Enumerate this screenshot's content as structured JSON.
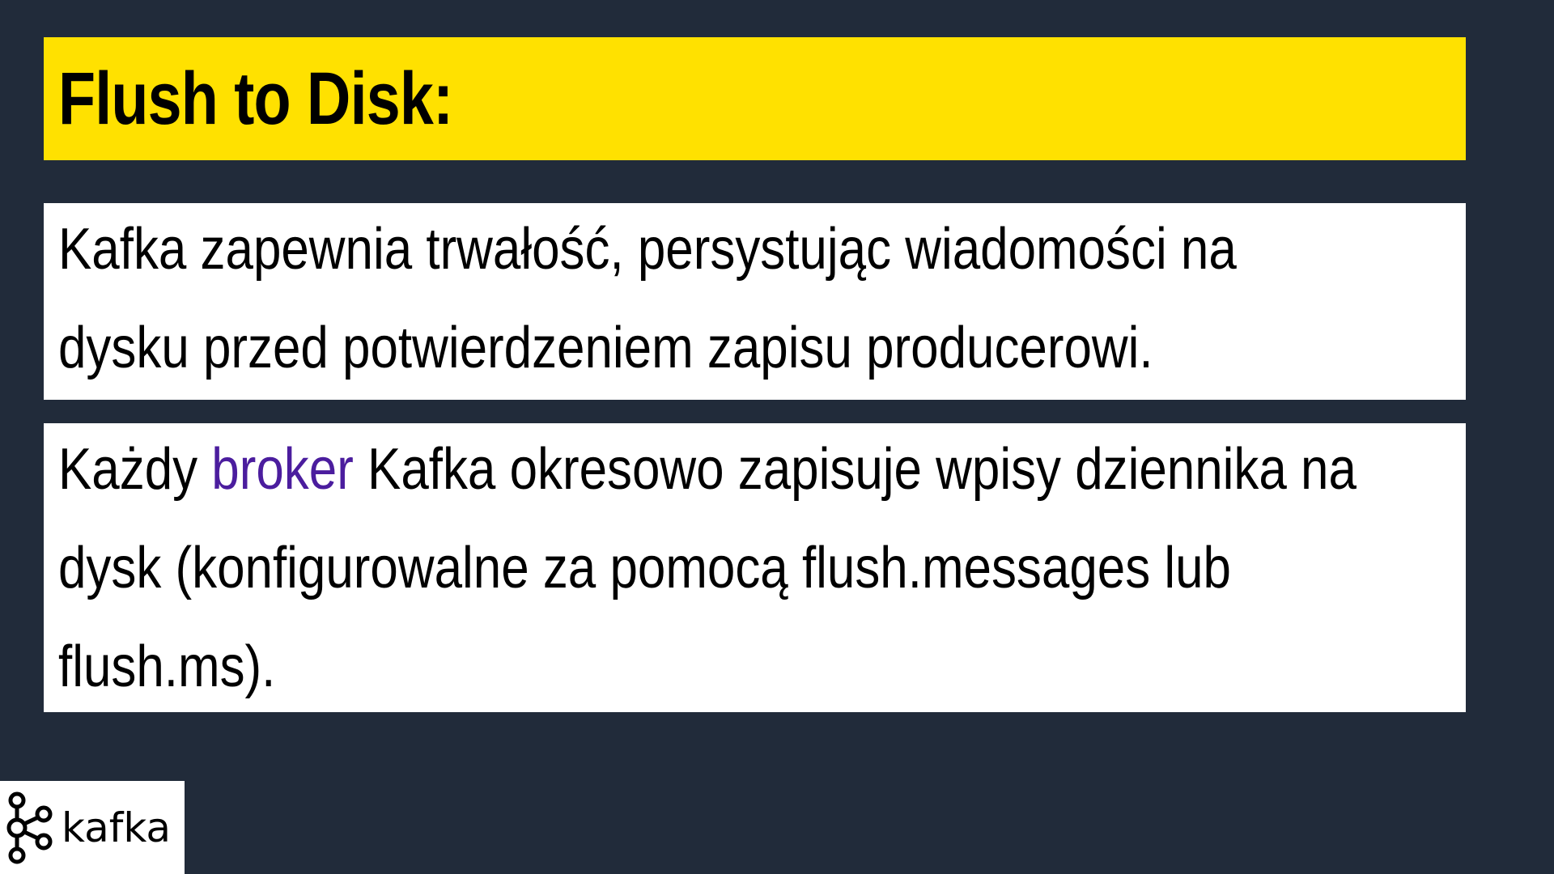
{
  "slide": {
    "title": "Flush to Disk:",
    "paragraph1": "Kafka zapewnia trwałość, persystując wiadomości na dysku przed potwierdzeniem zapisu producerowi.",
    "paragraph2": {
      "before": "Każdy ",
      "highlight": "broker",
      "after": " Kafka okresowo zapisuje wpisy dziennika na dysk (konfigurowalne za pomocą flush.messages lub flush.ms)."
    }
  },
  "logo": {
    "text": "kafka",
    "icon": "kafka-logo-icon"
  },
  "colors": {
    "background": "#212b3a",
    "title_bar": "#ffe100",
    "highlight": "#4b1d9e",
    "box": "#ffffff"
  }
}
